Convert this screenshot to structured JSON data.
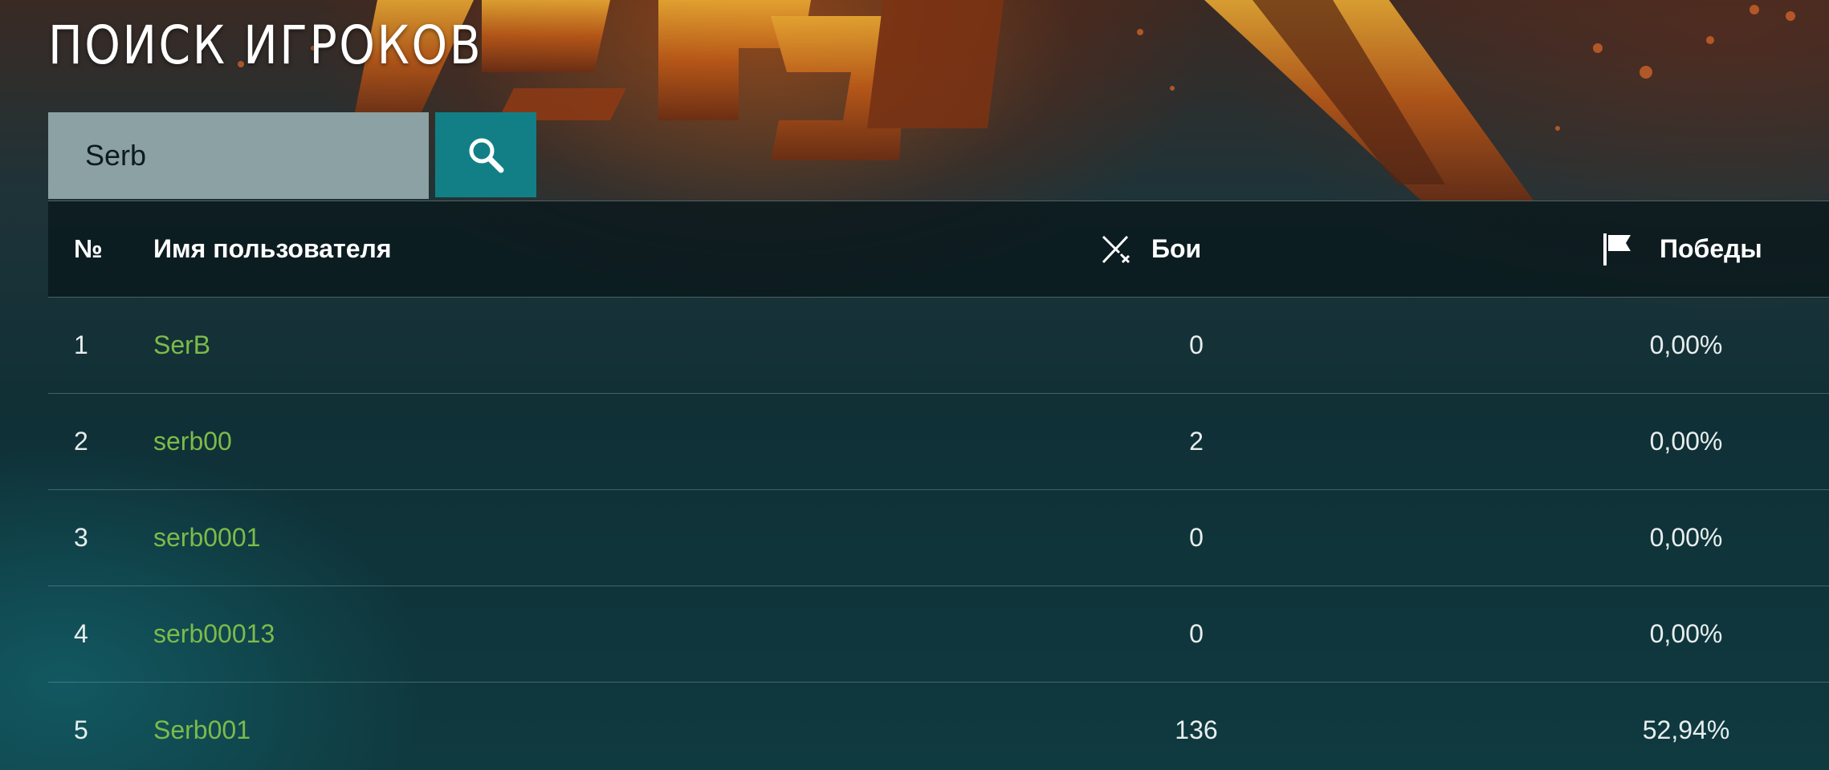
{
  "page": {
    "title": "ПОИСК ИГРОКОВ"
  },
  "search": {
    "value": "Serb",
    "icon": "search-icon"
  },
  "table": {
    "headers": {
      "number": "№",
      "username": "Имя пользователя",
      "battles": "Бои",
      "battles_icon": "crossed-swords-icon",
      "wins": "Победы",
      "wins_icon": "flag-icon"
    },
    "rows": [
      {
        "number": "1",
        "username": "SerB",
        "battles": "0",
        "wins": "0,00%"
      },
      {
        "number": "2",
        "username": "serb00",
        "battles": "2",
        "wins": "0,00%"
      },
      {
        "number": "3",
        "username": "serb0001",
        "battles": "0",
        "wins": "0,00%"
      },
      {
        "number": "4",
        "username": "serb00013",
        "battles": "0",
        "wins": "0,00%"
      },
      {
        "number": "5",
        "username": "Serb001",
        "battles": "136",
        "wins": "52,94%"
      }
    ]
  },
  "colors": {
    "accent": "#127f86",
    "username_link": "#7cbb4a",
    "search_field": "#8ba1a3"
  }
}
